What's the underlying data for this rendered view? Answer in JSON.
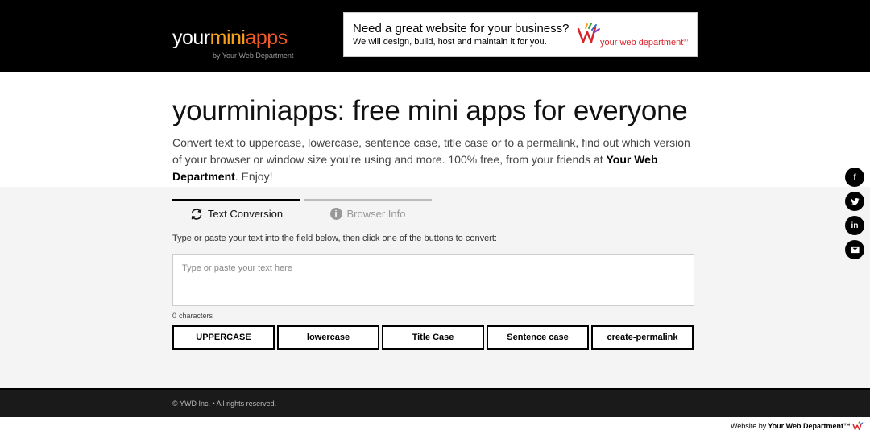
{
  "header": {
    "logo": {
      "part1": "your",
      "part2": "mini",
      "part3": "apps",
      "subtitle": "by Your Web Department"
    },
    "ad": {
      "headline": "Need a great website for your business?",
      "subline": "We will design, build, host and maintain it for you.",
      "brand": "your web department",
      "brand_mark": "tm"
    }
  },
  "hero": {
    "title": "yourminiapps: free mini apps for everyone",
    "description_pre": "Convert text to uppercase, lowercase, sentence case, title case or to a permalink, find out which version of your browser or window size you’re using and more. 100% free, from your friends at ",
    "description_bold": "Your Web Department",
    "description_post": ". Enjoy!"
  },
  "tabs": [
    {
      "label": "Text Conversion",
      "icon": "refresh-icon",
      "active": true
    },
    {
      "label": "Browser Info",
      "icon": "info-icon",
      "active": false
    }
  ],
  "converter": {
    "instructions": "Type or paste your text into the field below, then click one of the buttons to convert:",
    "placeholder": "Type or paste your text here",
    "value": "",
    "char_count": "0",
    "char_label": "characters",
    "buttons": [
      "UPPERCASE",
      "lowercase",
      "Title Case",
      "Sentence case",
      "create-permalink"
    ]
  },
  "footer": {
    "copyright": "© YWD Inc. • All rights reserved."
  },
  "credit": {
    "prefix": "Website by",
    "brand": "Your Web Department™"
  },
  "social": [
    {
      "name": "facebook-icon",
      "glyph": "f"
    },
    {
      "name": "twitter-icon",
      "glyph": ""
    },
    {
      "name": "linkedin-icon",
      "glyph": "in"
    },
    {
      "name": "email-icon",
      "glyph": ""
    }
  ],
  "colors": {
    "accent_orange": "#f7a11a",
    "accent_red": "#ef5a24",
    "brand_red": "#d8232a"
  }
}
